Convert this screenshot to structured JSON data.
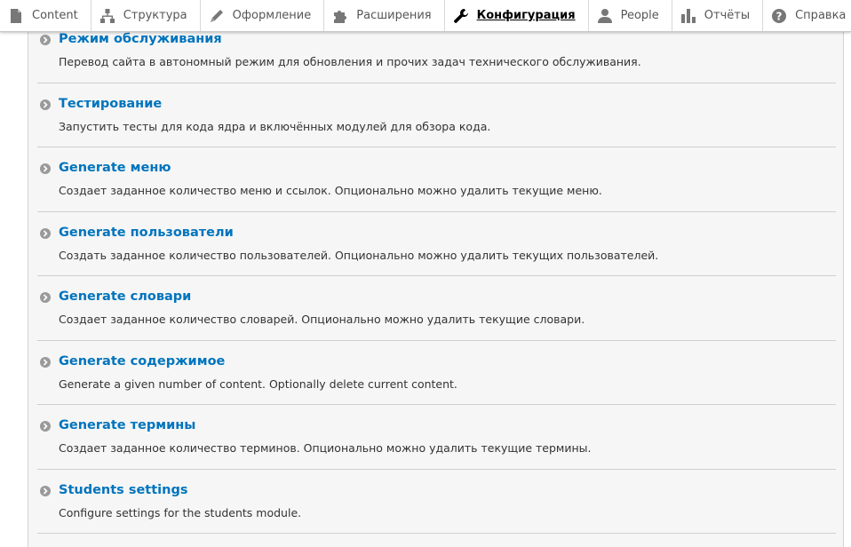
{
  "toolbar": {
    "items": [
      {
        "label": "Content",
        "icon": "file-icon",
        "active": false
      },
      {
        "label": "Структура",
        "icon": "sitemap-icon",
        "active": false
      },
      {
        "label": "Оформление",
        "icon": "brush-icon",
        "active": false
      },
      {
        "label": "Расширения",
        "icon": "puzzle-icon",
        "active": false
      },
      {
        "label": "Конфигурация",
        "icon": "wrench-icon",
        "active": true
      },
      {
        "label": "People",
        "icon": "person-icon",
        "active": false
      },
      {
        "label": "Отчёты",
        "icon": "bar-chart-icon",
        "active": false
      },
      {
        "label": "Справка",
        "icon": "help-icon",
        "active": false
      }
    ]
  },
  "colors": {
    "link": "#0074bd",
    "panel_bg": "#f6f6f6",
    "bullet": "#9a9a9a"
  },
  "config_list": [
    {
      "title": "Режим обслуживания",
      "description": "Перевод сайта в автономный режим для обновления и прочих задач технического обслуживания."
    },
    {
      "title": "Тестирование",
      "description": "Запустить тесты для кода ядра и включённых модулей для обзора кода."
    },
    {
      "title": "Generate меню",
      "description": "Создает заданное количество меню и ссылок. Опционально можно удалить текущие меню."
    },
    {
      "title": "Generate пользователи",
      "description": "Создать заданное количество пользователей. Опционально можно удалить текущих пользователей."
    },
    {
      "title": "Generate словари",
      "description": "Создает заданное количество словарей. Опционально можно удалить текущие словари."
    },
    {
      "title": "Generate содержимое",
      "description": "Generate a given number of content. Optionally delete current content."
    },
    {
      "title": "Generate термины",
      "description": "Создает заданное количество терминов. Опционально можно удалить текущие термины."
    },
    {
      "title": "Students settings",
      "description": "Configure settings for the students module."
    }
  ]
}
